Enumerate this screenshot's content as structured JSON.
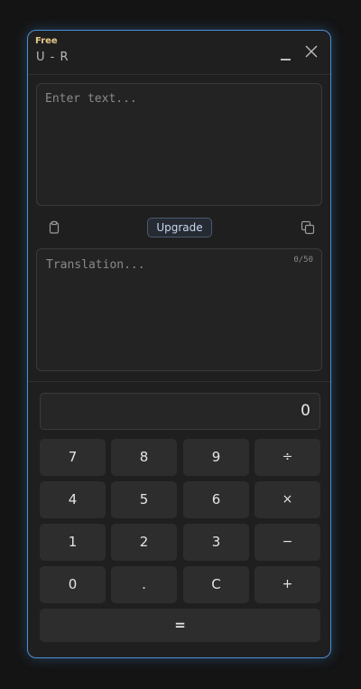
{
  "header": {
    "plan": "Free",
    "title": "U - R"
  },
  "input": {
    "placeholder": "Enter text..."
  },
  "toolbar": {
    "upgrade_label": "Upgrade"
  },
  "output": {
    "placeholder": "Translation...",
    "counter": "0/50"
  },
  "calculator": {
    "display": "0",
    "keys": {
      "k7": "7",
      "k8": "8",
      "k9": "9",
      "divide": "÷",
      "k4": "4",
      "k5": "5",
      "k6": "6",
      "multiply": "×",
      "k1": "1",
      "k2": "2",
      "k3": "3",
      "minus": "−",
      "k0": "0",
      "dot": ".",
      "clear": "C",
      "plus": "+",
      "equals": "="
    }
  },
  "colors": {
    "accent_border": "#4d8fd6",
    "plan_label": "#e6c98a",
    "background": "#1f1f1f"
  },
  "icons": {
    "clipboard": "clipboard-icon",
    "copy": "copy-icon",
    "close": "close-icon",
    "minimize": "minimize-icon"
  }
}
